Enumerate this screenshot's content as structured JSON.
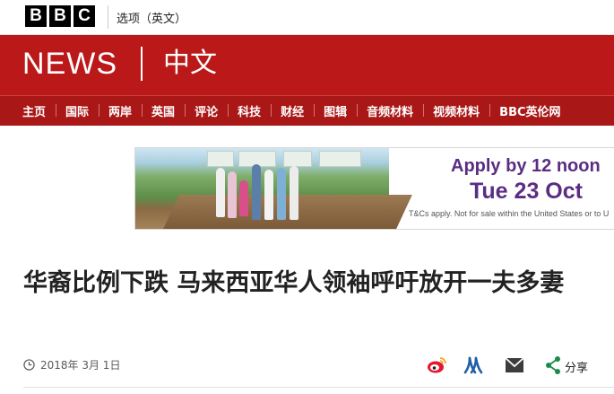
{
  "topbar": {
    "logo_letters": [
      "B",
      "B",
      "C"
    ],
    "language_link": "选项（英文）"
  },
  "header": {
    "news_word": "NEWS",
    "section_zh": "中文"
  },
  "nav": {
    "items": [
      "主页",
      "国际",
      "两岸",
      "英国",
      "评论",
      "科技",
      "财经",
      "图辑",
      "音频材料",
      "视频材料",
      "BBC英伦网"
    ]
  },
  "ad": {
    "line1": "Apply by 12 noon",
    "line2": "Tue 23 Oct",
    "disclaimer": "T&Cs apply. Not for sale within the United States or to U"
  },
  "article": {
    "headline": "华裔比例下跌 马来西亚华人领袖呼吁放开一夫多妻",
    "date": "2018年 3月 1日"
  },
  "share": {
    "label": "分享",
    "icons": [
      "weibo-icon",
      "renren-icon",
      "email-icon",
      "share-icon"
    ]
  },
  "colors": {
    "brand_red": "#bb1919",
    "nav_red": "#a91717",
    "ad_purple": "#5a2d82",
    "share_green": "#1d8a4b"
  }
}
